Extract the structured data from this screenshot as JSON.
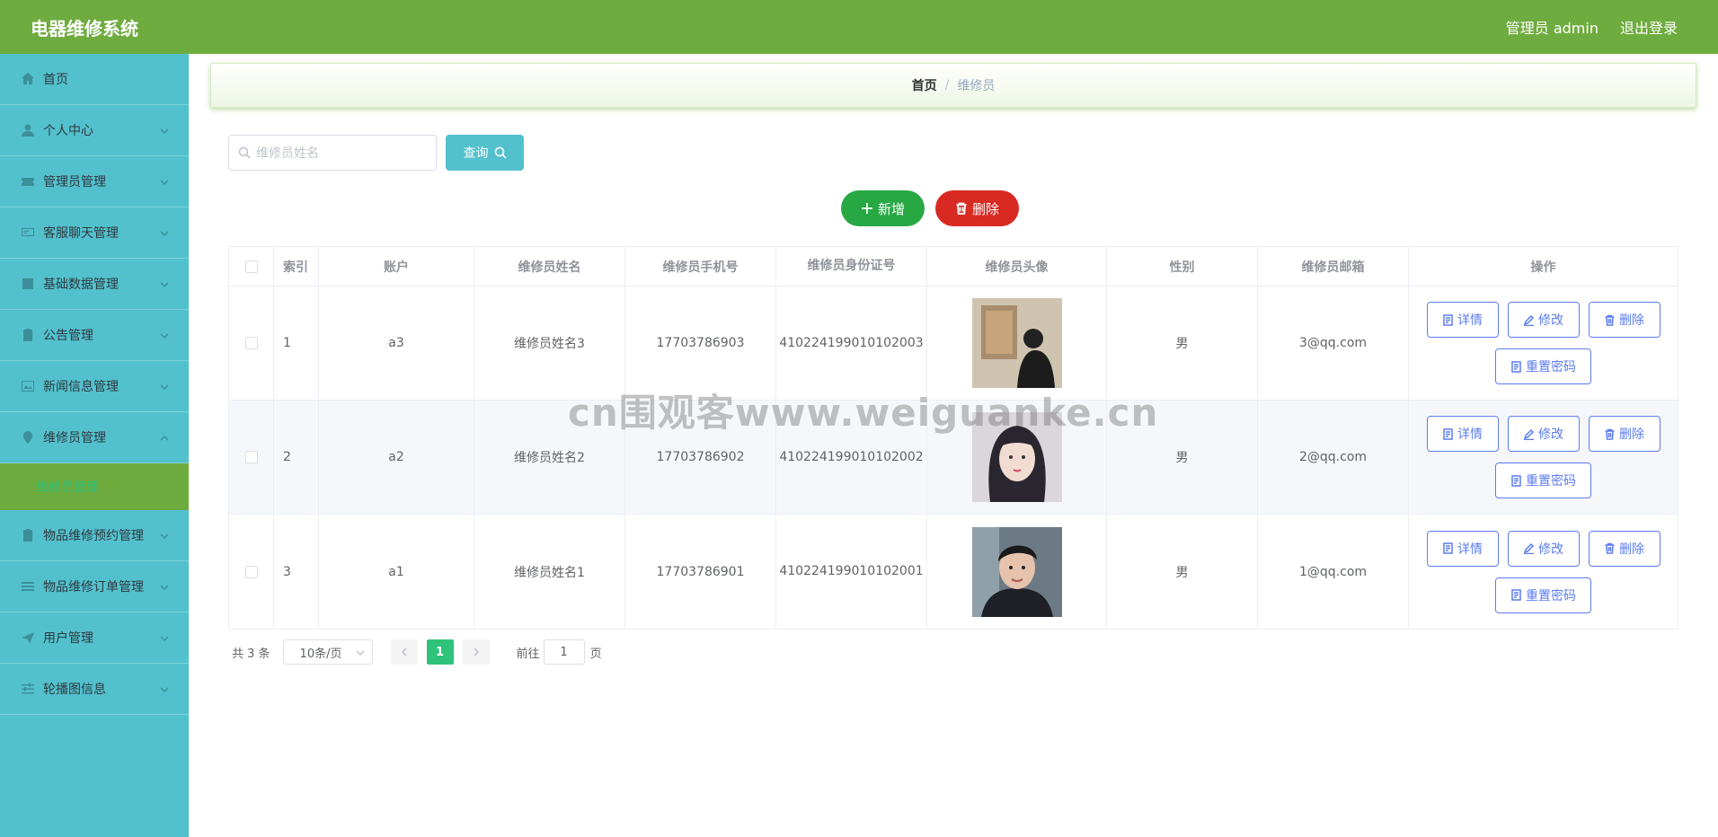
{
  "app": {
    "title": "电器维修系统",
    "user_label": "管理员 admin",
    "logout_label": "退出登录"
  },
  "sidebar": {
    "items": [
      {
        "label": "首页",
        "icon": "home-icon"
      },
      {
        "label": "个人中心",
        "icon": "user-icon"
      },
      {
        "label": "管理员管理",
        "icon": "ticket-icon"
      },
      {
        "label": "客服聊天管理",
        "icon": "chat-icon"
      },
      {
        "label": "基础数据管理",
        "icon": "data-icon"
      },
      {
        "label": "公告管理",
        "icon": "clipboard-icon"
      },
      {
        "label": "新闻信息管理",
        "icon": "news-icon"
      },
      {
        "label": "维修员管理",
        "icon": "location-icon"
      }
    ],
    "sub_item": "维修员管理",
    "items_after": [
      {
        "label": "物品维修预约管理",
        "icon": "clipboard-icon"
      },
      {
        "label": "物品维修订单管理",
        "icon": "list-icon"
      },
      {
        "label": "用户管理",
        "icon": "send-icon"
      },
      {
        "label": "轮播图信息",
        "icon": "sliders-icon"
      }
    ]
  },
  "breadcrumb": {
    "home": "首页",
    "separator": "/",
    "current": "维修员"
  },
  "search": {
    "placeholder": "维修员姓名",
    "button_label": "查询"
  },
  "actions": {
    "add_label": "新增",
    "delete_label": "删除"
  },
  "table": {
    "headers": [
      "索引",
      "账户",
      "维修员姓名",
      "维修员手机号",
      "维修员身份证号",
      "维修员头像",
      "性别",
      "维修员邮箱",
      "操作"
    ],
    "rows": [
      {
        "index": "1",
        "account": "a3",
        "name": "维修员姓名3",
        "phone": "17703786903",
        "id_card": "410224199010102003",
        "gender": "男",
        "email": "3@qq.com"
      },
      {
        "index": "2",
        "account": "a2",
        "name": "维修员姓名2",
        "phone": "17703786902",
        "id_card": "410224199010102002",
        "gender": "男",
        "email": "2@qq.com"
      },
      {
        "index": "3",
        "account": "a1",
        "name": "维修员姓名1",
        "phone": "17703786901",
        "id_card": "410224199010102001",
        "gender": "男",
        "email": "1@qq.com"
      }
    ],
    "row_actions": {
      "detail": "详情",
      "edit": "修改",
      "delete": "删除",
      "reset": "重置密码"
    }
  },
  "pagination": {
    "total": "共 3 条",
    "page_size": "10条/页",
    "current_page": "1",
    "goto_prefix": "前往",
    "goto_value": "1",
    "goto_suffix": "页"
  },
  "watermark": "cn围观客www.weiguanke.cn",
  "colors": {
    "header": "#6fac3f",
    "sidebar": "#53c0cd",
    "accent_green": "#2ec27a",
    "add": "#27a843",
    "delete": "#d82a22",
    "op_blue": "#5b7cf0"
  }
}
